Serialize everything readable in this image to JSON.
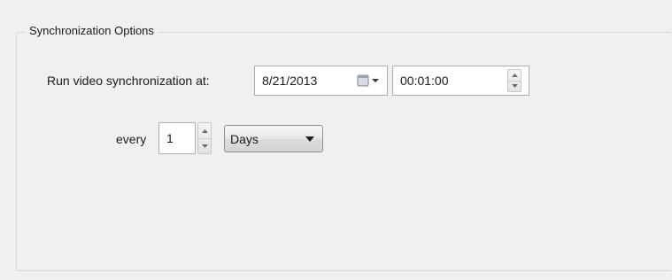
{
  "group": {
    "title": "Synchronization Options"
  },
  "schedule": {
    "run_label": "Run video synchronization at:",
    "date_value": "8/21/2013",
    "time_value": "00:01:00",
    "every_label": "every",
    "interval_value": "1",
    "unit_selected": "Days"
  },
  "icons": {
    "calendar": "calendar-dropdown-icon",
    "spin_up": "arrow-up-icon",
    "spin_down": "arrow-down-icon",
    "combo_arrow": "chevron-down-icon"
  },
  "colors": {
    "background": "#f0f0f0",
    "field_border": "#abadb3",
    "group_border": "#d5d5d5"
  }
}
